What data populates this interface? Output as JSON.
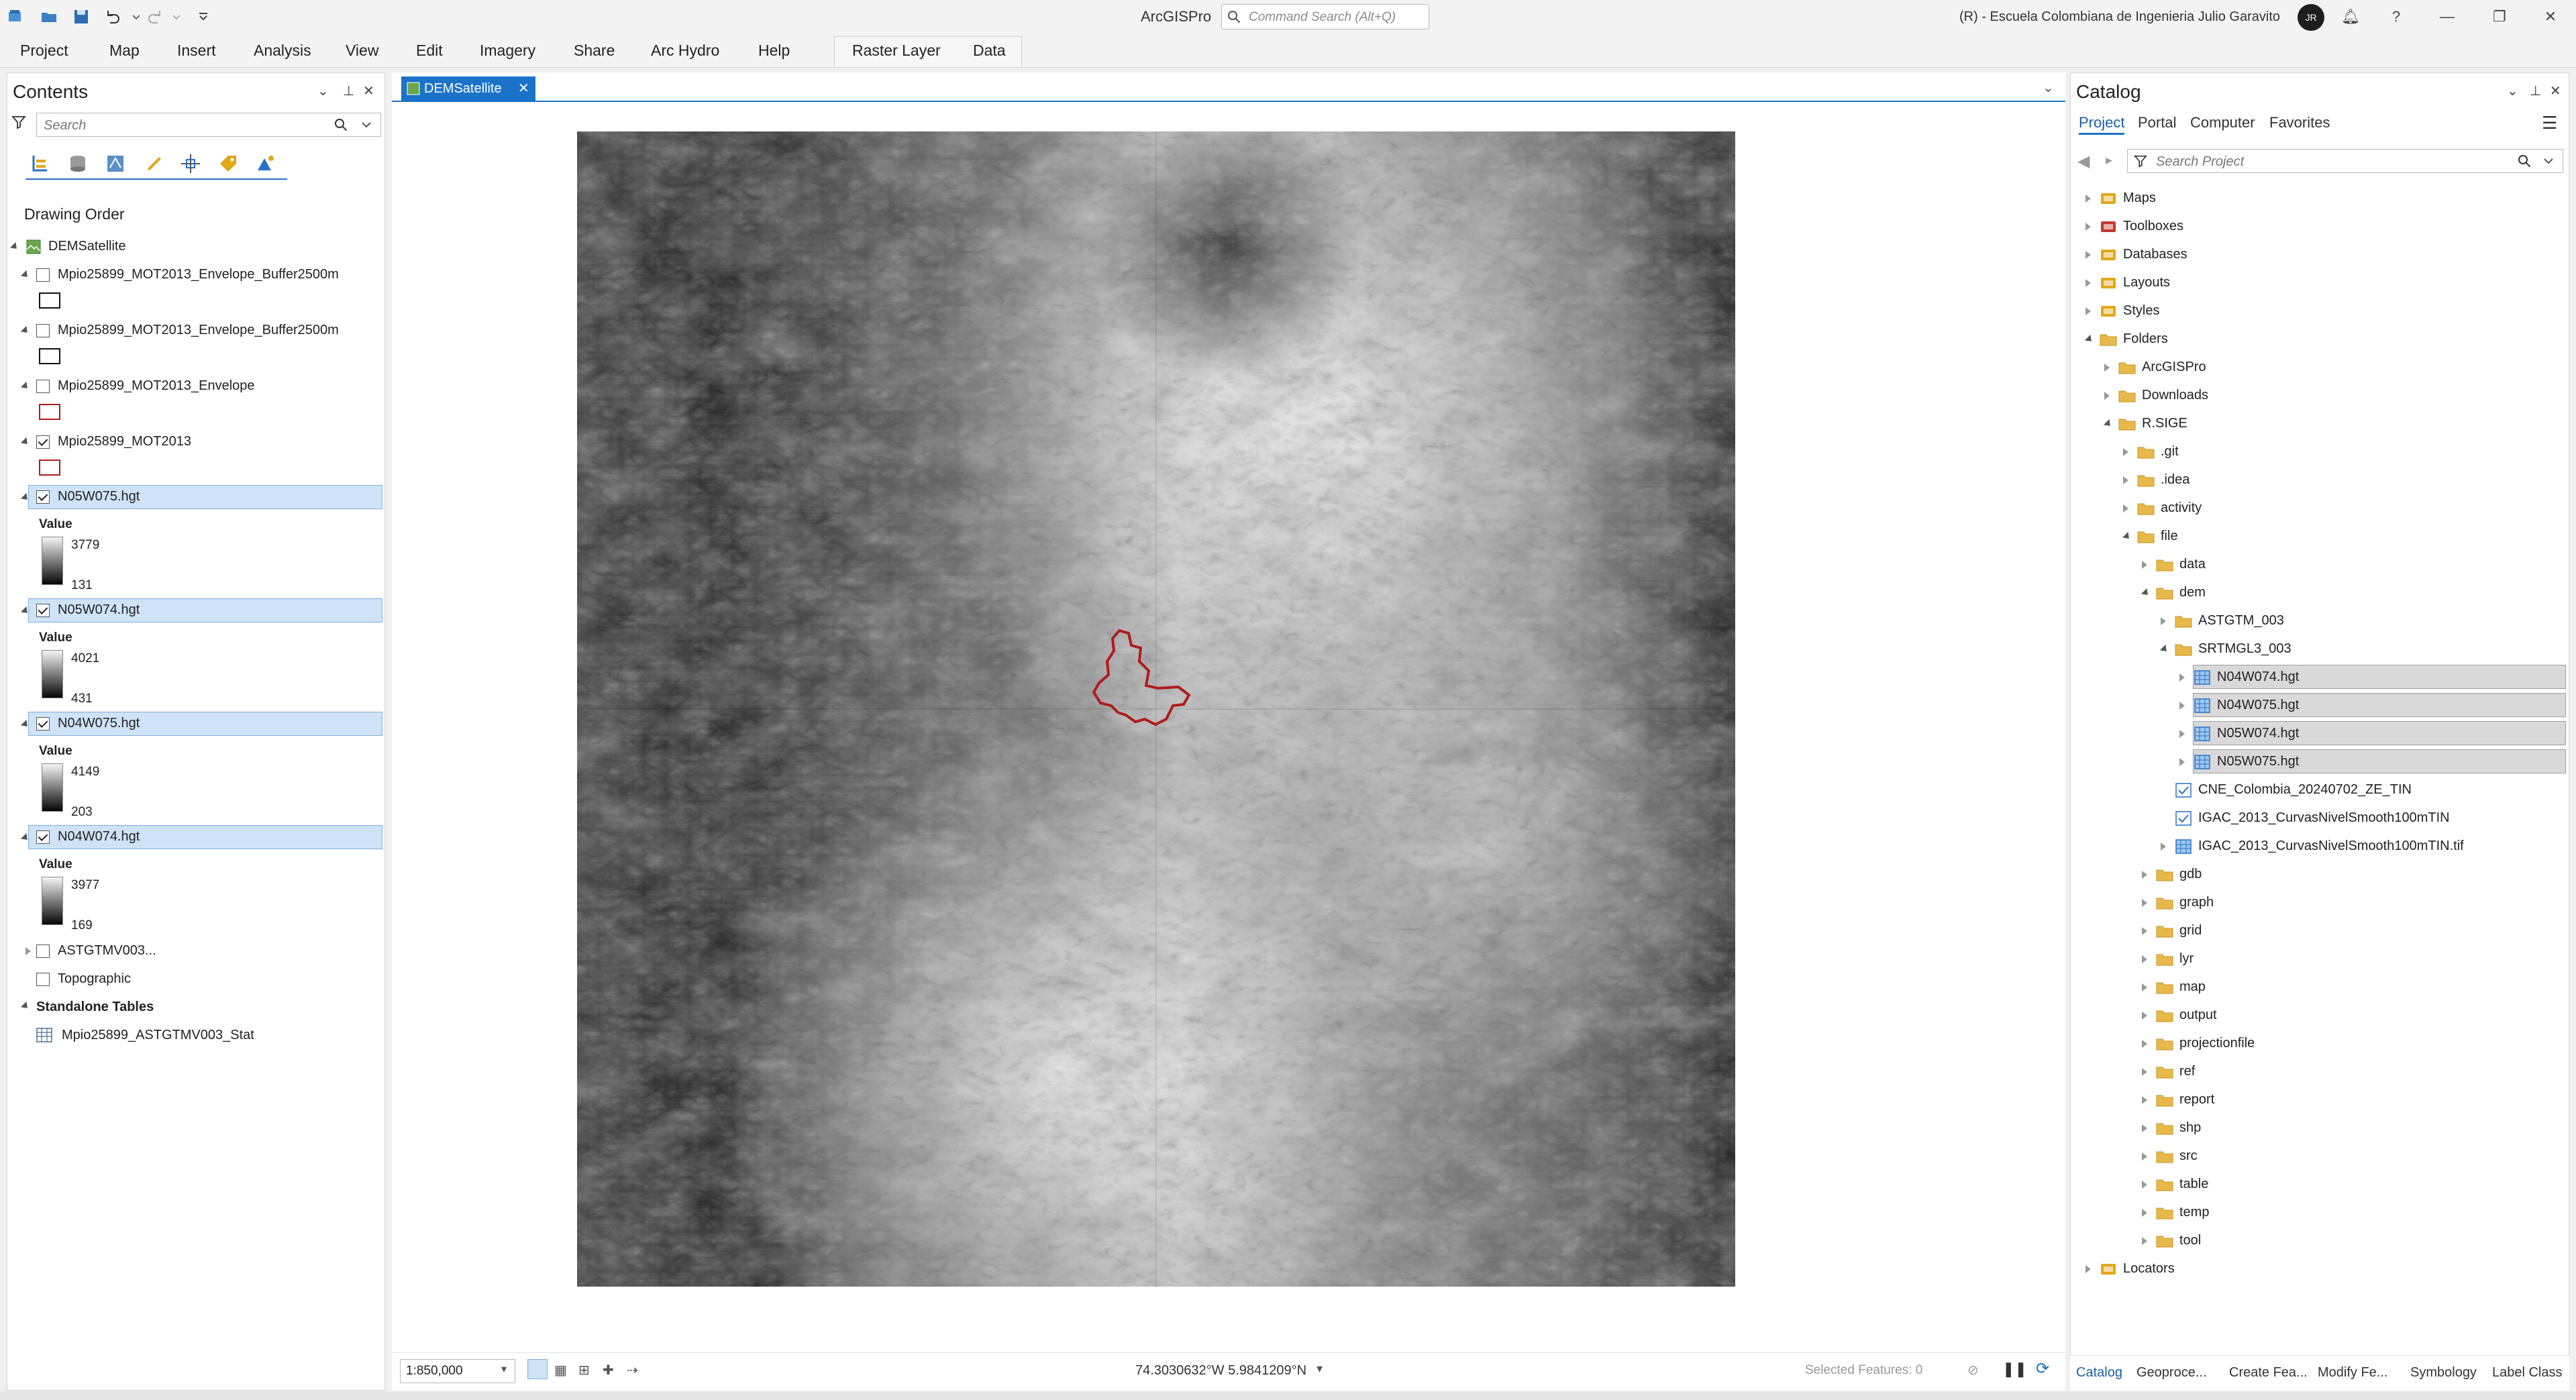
{
  "app": {
    "title": "ArcGISPro",
    "command_search_placeholder": "Command Search (Alt+Q)",
    "account": "(R) - Escuela Colombiana de Ingenieria Julio Garavito",
    "avatar_initials": "JR"
  },
  "ribbon": {
    "tabs": [
      "Project",
      "Map",
      "Insert",
      "Analysis",
      "View",
      "Edit",
      "Imagery",
      "Share",
      "Arc Hydro",
      "Help"
    ],
    "contextual_tabs": [
      "Raster Layer",
      "Data"
    ]
  },
  "contents": {
    "title": "Contents",
    "search_placeholder": "Search",
    "drawing_order_label": "Drawing Order",
    "map_name": "DEMSatellite",
    "layers": [
      {
        "name": "Mpio25899_MOT2013_Envelope_Buffer2500m",
        "checked": false,
        "symbol": "black"
      },
      {
        "name": "Mpio25899_MOT2013_Envelope_Buffer2500m",
        "checked": false,
        "symbol": "black"
      },
      {
        "name": "Mpio25899_MOT2013_Envelope",
        "checked": false,
        "symbol": "red"
      },
      {
        "name": "Mpio25899_MOT2013",
        "checked": true,
        "symbol": "red"
      }
    ],
    "rasters": [
      {
        "name": "N05W075.hgt",
        "value_label": "Value",
        "max": "3779",
        "min": "131"
      },
      {
        "name": "N05W074.hgt",
        "value_label": "Value",
        "max": "4021",
        "min": "431"
      },
      {
        "name": "N04W075.hgt",
        "value_label": "Value",
        "max": "4149",
        "min": "203"
      },
      {
        "name": "N04W074.hgt",
        "value_label": "Value",
        "max": "3977",
        "min": "169"
      }
    ],
    "other_layers": [
      "ASTGTMV003...",
      "Topographic"
    ],
    "standalone_tables_label": "Standalone Tables",
    "table_name": "Mpio25899_ASTGTMV003_Stat"
  },
  "map": {
    "tab_label": "DEMSatellite",
    "scale": "1:850,000",
    "coordinates": "74.3030632°W 5.9841209°N",
    "selected_features": "Selected Features: 0"
  },
  "catalog": {
    "title": "Catalog",
    "tabs": [
      "Project",
      "Portal",
      "Computer",
      "Favorites"
    ],
    "search_placeholder": "Search Project",
    "tree": [
      {
        "label": "Maps",
        "level": 0
      },
      {
        "label": "Toolboxes",
        "level": 0
      },
      {
        "label": "Databases",
        "level": 0
      },
      {
        "label": "Layouts",
        "level": 0
      },
      {
        "label": "Styles",
        "level": 0
      },
      {
        "label": "Folders",
        "level": 0
      },
      {
        "label": "ArcGISPro",
        "level": 1
      },
      {
        "label": "Downloads",
        "level": 1
      },
      {
        "label": "R.SIGE",
        "level": 1
      },
      {
        "label": ".git",
        "level": 2
      },
      {
        "label": ".idea",
        "level": 2
      },
      {
        "label": "activity",
        "level": 2
      },
      {
        "label": "file",
        "level": 2
      },
      {
        "label": "data",
        "level": 3
      },
      {
        "label": "dem",
        "level": 3
      },
      {
        "label": "ASTGTM_003",
        "level": 4
      },
      {
        "label": "SRTMGL3_003",
        "level": 4
      },
      {
        "label": "N04W074.hgt",
        "level": 5
      },
      {
        "label": "N04W075.hgt",
        "level": 5
      },
      {
        "label": "N05W074.hgt",
        "level": 5
      },
      {
        "label": "N05W075.hgt",
        "level": 5
      },
      {
        "label": "CNE_Colombia_20240702_ZE_TIN",
        "level": 4
      },
      {
        "label": "IGAC_2013_CurvasNivelSmooth100mTIN",
        "level": 4
      },
      {
        "label": "IGAC_2013_CurvasNivelSmooth100mTIN.tif",
        "level": 4
      },
      {
        "label": "gdb",
        "level": 3
      },
      {
        "label": "graph",
        "level": 3
      },
      {
        "label": "grid",
        "level": 3
      },
      {
        "label": "lyr",
        "level": 3
      },
      {
        "label": "map",
        "level": 3
      },
      {
        "label": "output",
        "level": 3
      },
      {
        "label": "projectionfile",
        "level": 3
      },
      {
        "label": "ref",
        "level": 3
      },
      {
        "label": "report",
        "level": 3
      },
      {
        "label": "shp",
        "level": 3
      },
      {
        "label": "src",
        "level": 3
      },
      {
        "label": "table",
        "level": 3
      },
      {
        "label": "temp",
        "level": 3
      },
      {
        "label": "tool",
        "level": 3
      },
      {
        "label": "Locators",
        "level": 0
      }
    ],
    "bottom_tabs": [
      "Catalog",
      "Geoproce...",
      "Create Fea...",
      "Modify Fe...",
      "Symbology",
      "Label Class"
    ]
  },
  "colors": {
    "accent": "#1a73c9",
    "selection": "#cfe3f8",
    "boundary": "#b01b1b",
    "folder": "#e8b84a"
  }
}
